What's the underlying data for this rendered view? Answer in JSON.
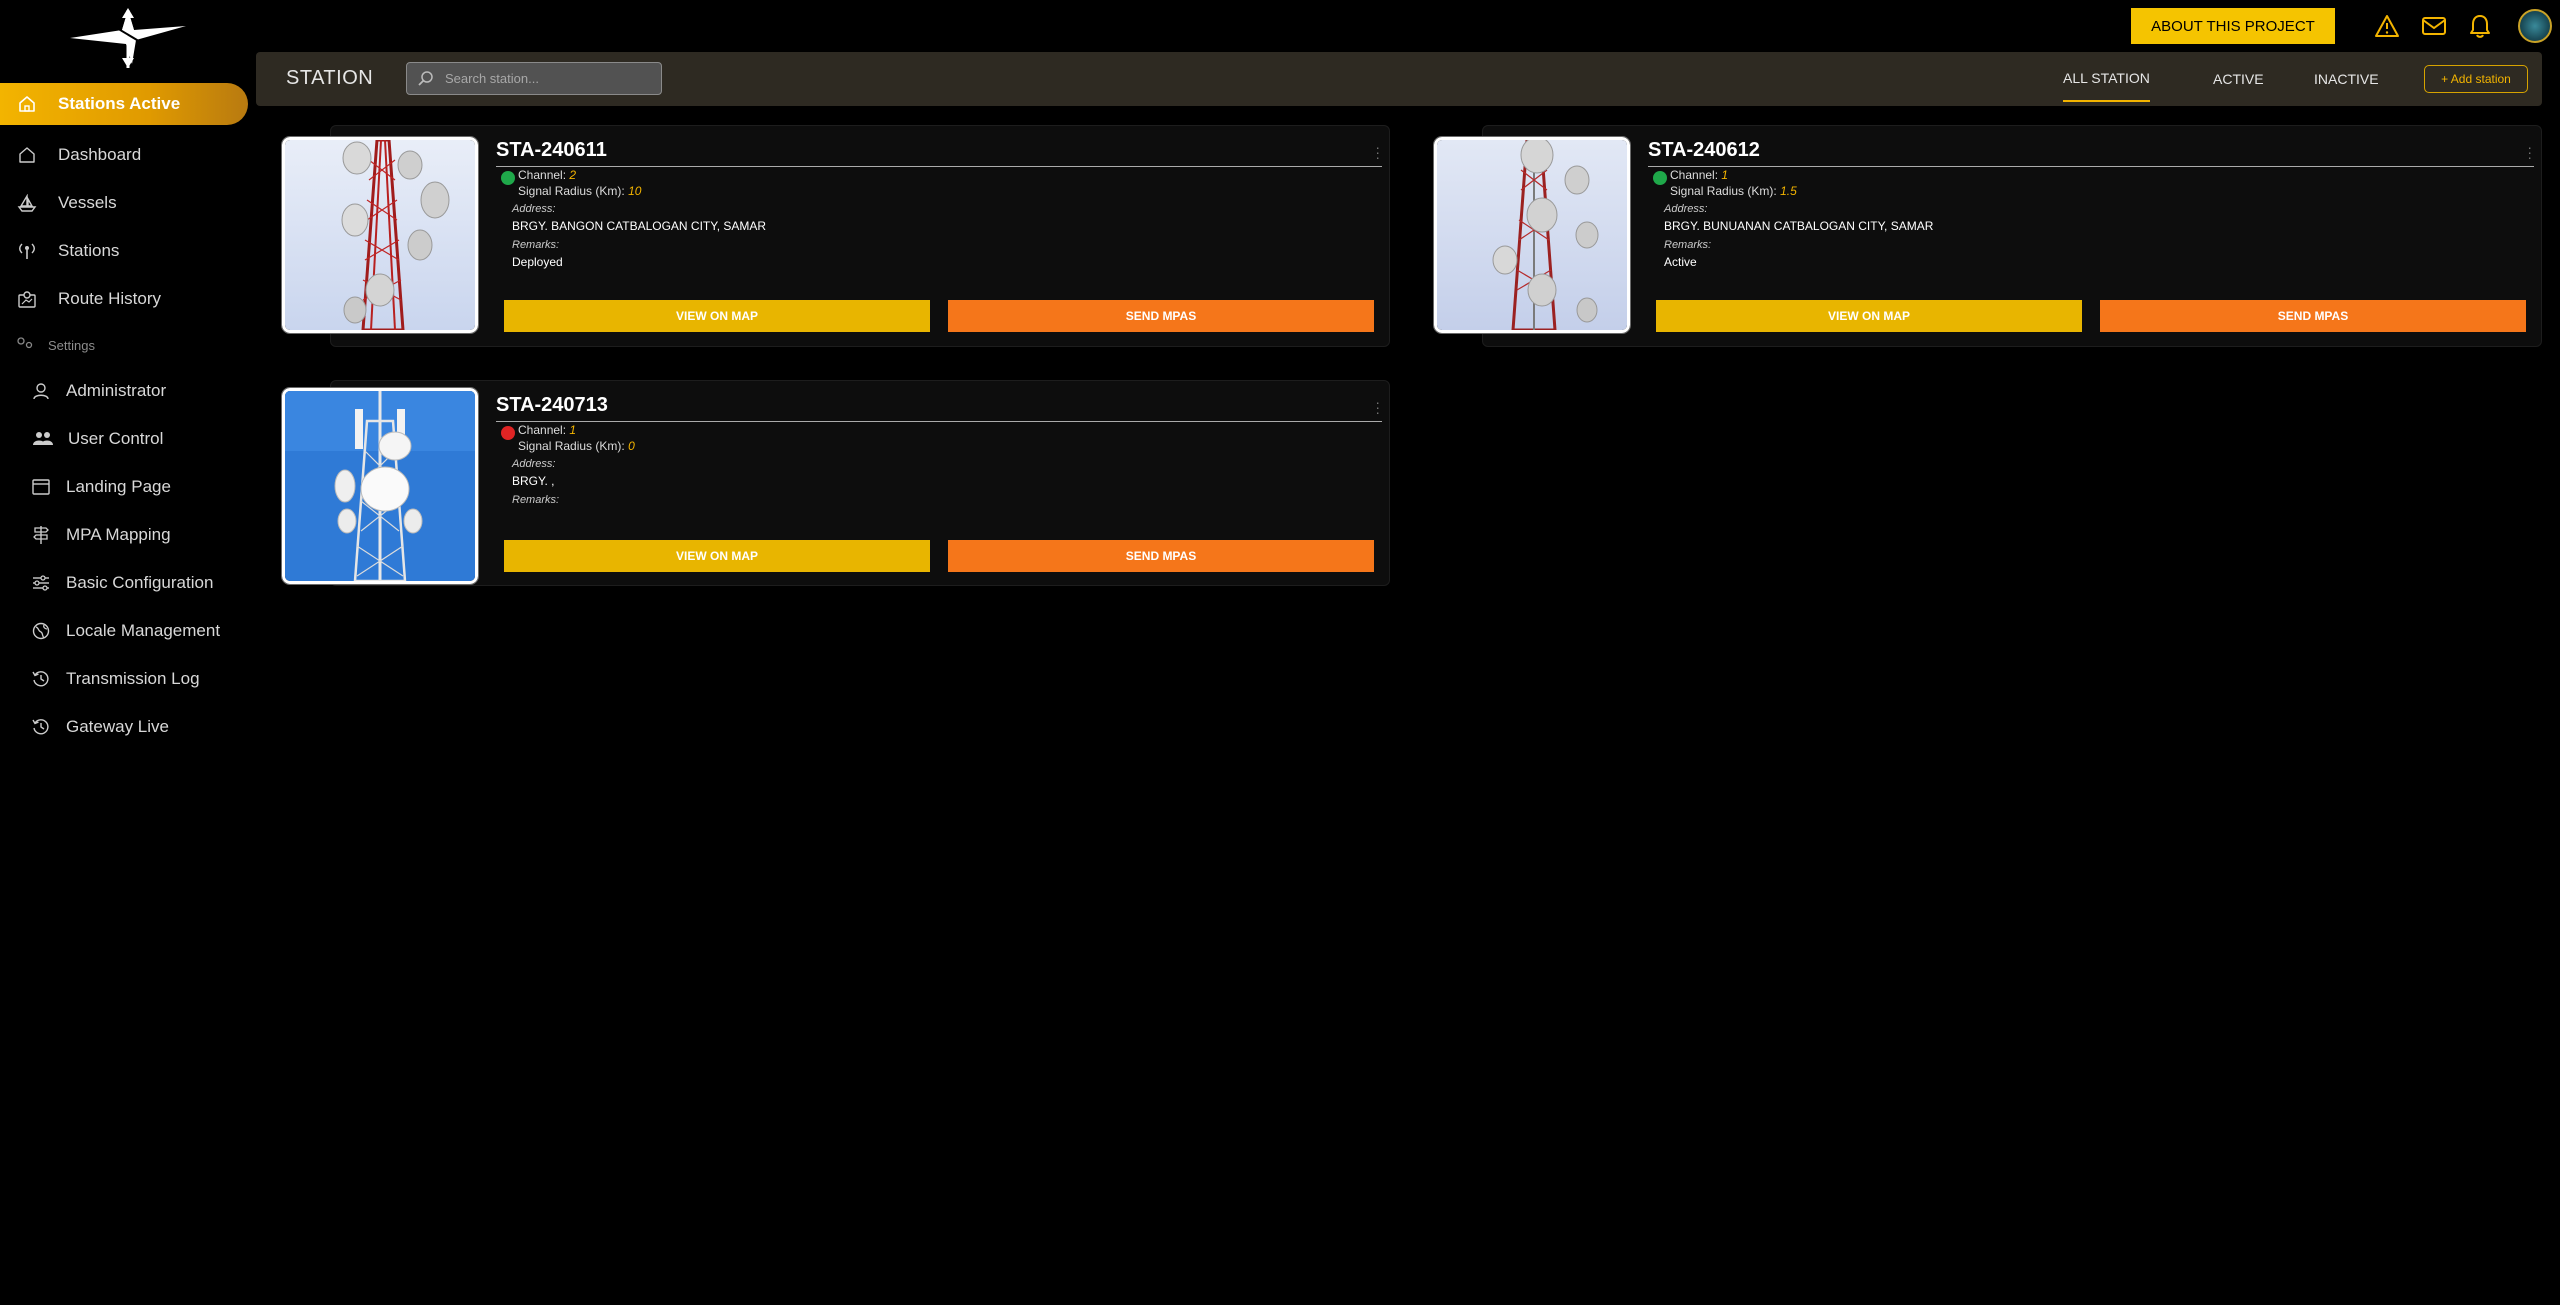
{
  "topbar": {
    "about_label": "ABOUT THIS PROJECT",
    "icons": [
      "warning-icon",
      "mail-icon",
      "bell-icon",
      "avatar"
    ]
  },
  "sidebar": {
    "active_item": "Stations Active",
    "items": [
      {
        "label": "Dashboard",
        "icon": "home-icon"
      },
      {
        "label": "Vessels",
        "icon": "ship-icon"
      },
      {
        "label": "Stations",
        "icon": "antenna-icon"
      },
      {
        "label": "Route History",
        "icon": "route-icon"
      }
    ],
    "settings_label": "Settings",
    "settings_items": [
      {
        "label": "Administrator",
        "icon": "user-icon"
      },
      {
        "label": "User Control",
        "icon": "users-icon"
      },
      {
        "label": "Landing Page",
        "icon": "window-icon"
      },
      {
        "label": "MPA Mapping",
        "icon": "signpost-icon"
      },
      {
        "label": "Basic Configuration",
        "icon": "sliders-icon"
      },
      {
        "label": "Locale Management",
        "icon": "globe-icon"
      },
      {
        "label": "Transmission Log",
        "icon": "history-icon"
      },
      {
        "label": "Gateway Live",
        "icon": "history-icon"
      }
    ]
  },
  "header": {
    "title": "STATION",
    "search_placeholder": "Search station...",
    "tabs": [
      "ALL STATION",
      "ACTIVE",
      "INACTIVE"
    ],
    "active_tab": "ALL STATION",
    "add_label": "+ Add station"
  },
  "labels": {
    "channel": "Channel:",
    "signal": "Signal Radius (Km):",
    "address": "Address:",
    "remarks": "Remarks:",
    "view_map": "VIEW ON MAP",
    "send_mpas": "SEND MPAS"
  },
  "colors": {
    "accent": "#f3b400",
    "send_button": "#f5761a",
    "status_active": "#1fa84a",
    "status_inactive": "#e02424"
  },
  "stations": [
    {
      "name": "STA-240611",
      "status": "active",
      "channel": "2",
      "signal": "10",
      "address": "BRGY. BANGON CATBALOGAN CITY, SAMAR",
      "remarks": "Deployed"
    },
    {
      "name": "STA-240612",
      "status": "active",
      "channel": "1",
      "signal": "1.5",
      "address": "BRGY. BUNUANAN CATBALOGAN CITY, SAMAR",
      "remarks": "Active"
    },
    {
      "name": "STA-240713",
      "status": "inactive",
      "channel": "1",
      "signal": "0",
      "address": "BRGY. ,",
      "remarks": ""
    }
  ]
}
